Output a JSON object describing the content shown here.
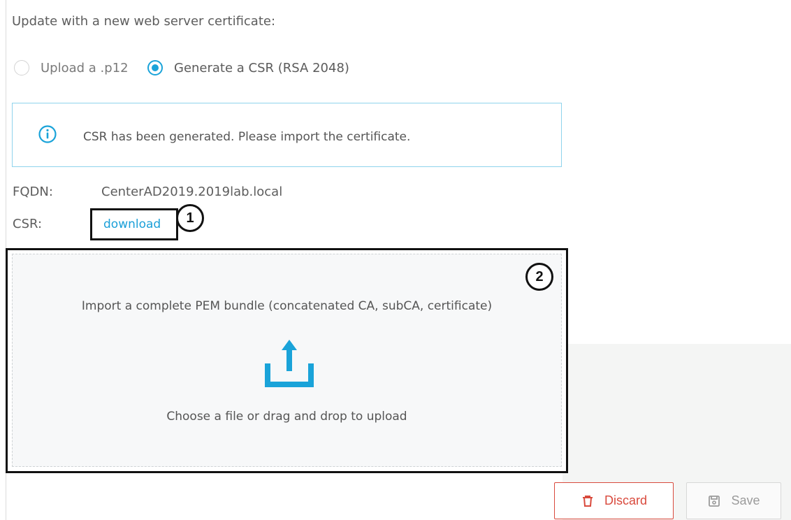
{
  "certificate_update": {
    "title": "Update with a new web server certificate:",
    "options": [
      {
        "label": "Upload a .p12",
        "selected": false
      },
      {
        "label": "Generate a CSR (RSA 2048)",
        "selected": true
      }
    ],
    "info_message": "CSR has been generated. Please import the certificate.",
    "fqdn": {
      "label": "FQDN:",
      "value": "CenterAD2019.2019lab.local"
    },
    "csr": {
      "label": "CSR:",
      "link_text": "download"
    },
    "dropzone": {
      "title": "Import a complete PEM bundle (concatenated CA, subCA, certificate)",
      "subtitle": "Choose a file or drag and drop to upload",
      "icon": "upload-icon"
    },
    "callouts": [
      "1",
      "2"
    ],
    "actions": {
      "discard_label": "Discard",
      "save_label": "Save"
    }
  },
  "colors": {
    "accent": "#1aa3d9",
    "info_border": "#8fd3ec",
    "danger": "#d94a3d",
    "disabled": "#9b9b9b",
    "annotation": "#111111"
  }
}
